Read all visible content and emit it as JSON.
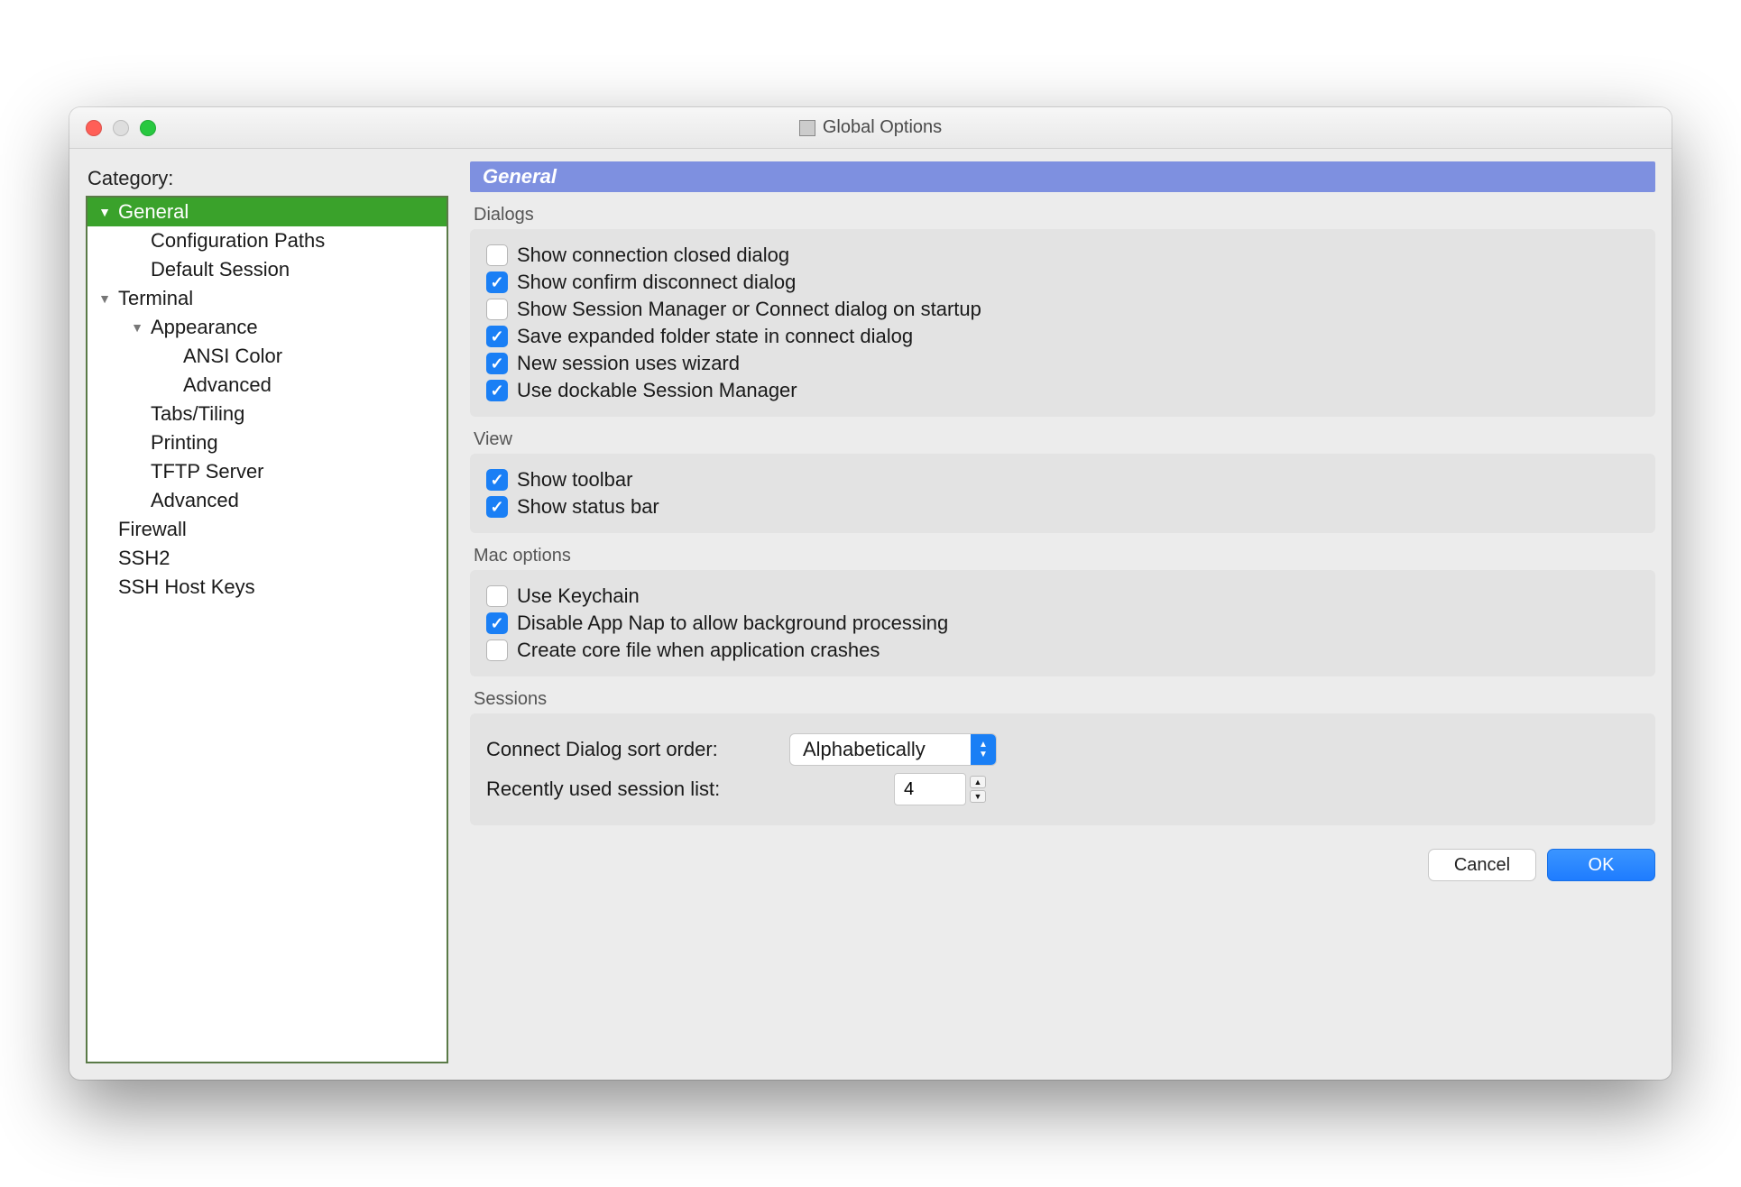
{
  "window": {
    "title": "Global Options"
  },
  "sidebar": {
    "label": "Category:",
    "items": [
      {
        "label": "General",
        "level": 0,
        "expanded": true,
        "selected": true
      },
      {
        "label": "Configuration Paths",
        "level": 1
      },
      {
        "label": "Default Session",
        "level": 1
      },
      {
        "label": "Terminal",
        "level": 0,
        "expanded": true
      },
      {
        "label": "Appearance",
        "level": 1,
        "expanded": true
      },
      {
        "label": "ANSI Color",
        "level": 2
      },
      {
        "label": "Advanced",
        "level": 2
      },
      {
        "label": "Tabs/Tiling",
        "level": 1
      },
      {
        "label": "Printing",
        "level": 1
      },
      {
        "label": "TFTP Server",
        "level": 1
      },
      {
        "label": "Advanced",
        "level": 1
      },
      {
        "label": "Firewall",
        "level": 0
      },
      {
        "label": "SSH2",
        "level": 0
      },
      {
        "label": "SSH Host Keys",
        "level": 0
      }
    ]
  },
  "panel": {
    "title": "General",
    "dialogs": {
      "label": "Dialogs",
      "items": [
        {
          "label": "Show connection closed dialog",
          "checked": false
        },
        {
          "label": "Show confirm disconnect dialog",
          "checked": true
        },
        {
          "label": "Show Session Manager or Connect dialog on startup",
          "checked": false
        },
        {
          "label": "Save expanded folder state in connect dialog",
          "checked": true
        },
        {
          "label": "New session uses wizard",
          "checked": true
        },
        {
          "label": "Use dockable Session Manager",
          "checked": true
        }
      ]
    },
    "view": {
      "label": "View",
      "items": [
        {
          "label": "Show toolbar",
          "checked": true
        },
        {
          "label": "Show status bar",
          "checked": true
        }
      ]
    },
    "mac": {
      "label": "Mac options",
      "items": [
        {
          "label": "Use Keychain",
          "checked": false
        },
        {
          "label": "Disable App Nap to allow background processing",
          "checked": true
        },
        {
          "label": "Create core file when application crashes",
          "checked": false
        }
      ]
    },
    "sessions": {
      "label": "Sessions",
      "sort_label": "Connect Dialog sort order:",
      "sort_value": "Alphabetically",
      "recent_label": "Recently used session list:",
      "recent_value": "4"
    }
  },
  "buttons": {
    "cancel": "Cancel",
    "ok": "OK"
  }
}
